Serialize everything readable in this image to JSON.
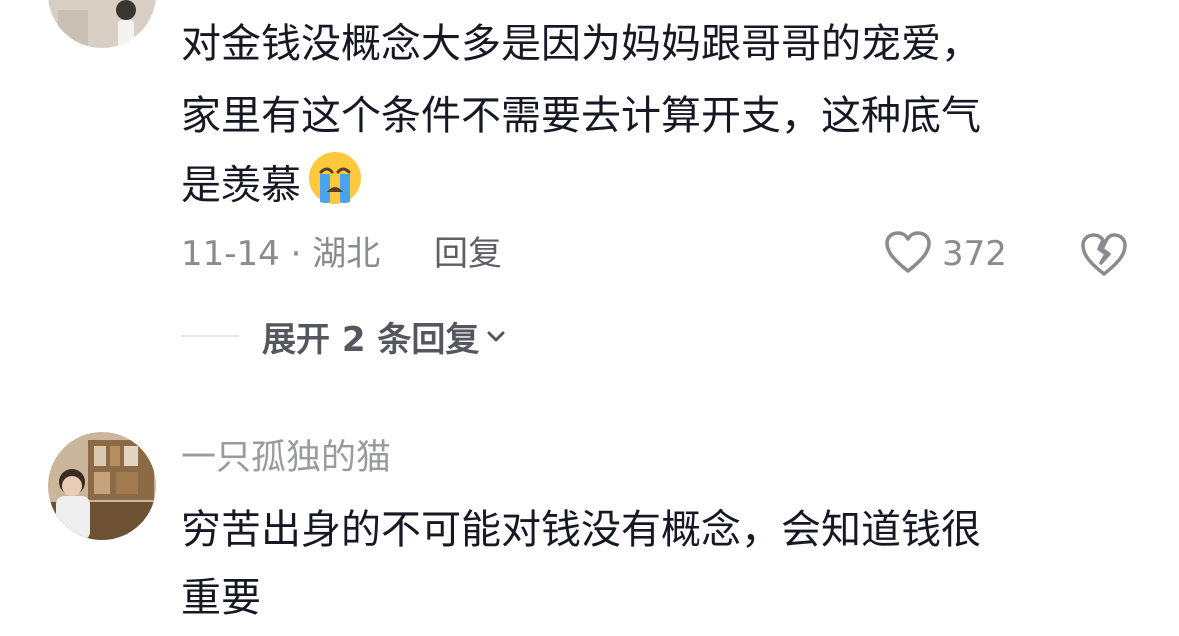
{
  "comment1": {
    "lines": [
      "对金钱没概念大多是因为妈妈跟哥哥的宠爱，",
      "家里有这个条件不需要去计算开支，这种底气",
      "是羡慕"
    ],
    "emoji": "loudly-crying-face",
    "date_location": "11-14 · 湖北",
    "reply_label": "回复",
    "like_count": "372",
    "expand_replies_label": "展开 2 条回复"
  },
  "comment2": {
    "username": "一只孤独的猫",
    "lines": [
      "穷苦出身的不可能对钱没有概念，会知道钱很",
      "重要"
    ]
  },
  "colors": {
    "text": "#161823",
    "secondary": "#8a8b91",
    "username": "#9a9ba0",
    "emoji_yellow": "#ffc83d",
    "tears_blue": "#4aa3ee"
  },
  "icons": {
    "like": "heart-outline-icon",
    "dislike": "broken-heart-icon",
    "expand": "chevron-down-icon"
  }
}
